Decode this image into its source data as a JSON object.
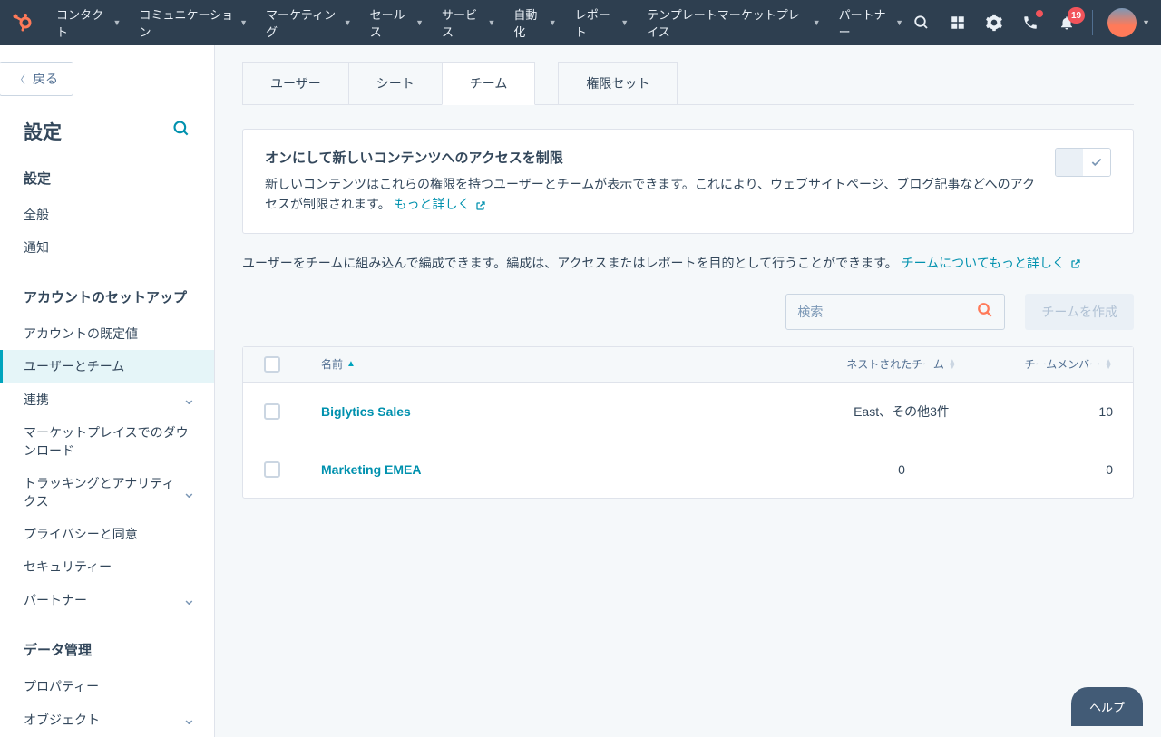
{
  "topnav": {
    "items": [
      "コンタクト",
      "コミュニケーション",
      "マーケティング",
      "セールス",
      "サービス",
      "自動化",
      "レポート",
      "テンプレートマーケットプレイス",
      "パートナー"
    ],
    "bell_badge": "19"
  },
  "sidebar": {
    "back": "戻る",
    "title": "設定",
    "sections": [
      {
        "heading": "設定",
        "items": [
          {
            "label": "全般"
          },
          {
            "label": "通知"
          }
        ]
      },
      {
        "heading": "アカウントのセットアップ",
        "items": [
          {
            "label": "アカウントの既定値"
          },
          {
            "label": "ユーザーとチーム",
            "active": true
          },
          {
            "label": "連携",
            "expandable": true
          },
          {
            "label": "マーケットプレイスでのダウンロード"
          },
          {
            "label": "トラッキングとアナリティクス",
            "expandable": true
          },
          {
            "label": "プライバシーと同意"
          },
          {
            "label": "セキュリティー"
          },
          {
            "label": "パートナー",
            "expandable": true
          }
        ]
      },
      {
        "heading": "データ管理",
        "items": [
          {
            "label": "プロパティー"
          },
          {
            "label": "オブジェクト",
            "expandable": true
          }
        ]
      }
    ]
  },
  "tabs": [
    {
      "label": "ユーザー"
    },
    {
      "label": "シート"
    },
    {
      "label": "チーム",
      "active": true
    },
    {
      "label": "権限セット",
      "detached": true
    }
  ],
  "notice": {
    "title": "オンにして新しいコンテンツへのアクセスを制限",
    "desc": "新しいコンテンツはこれらの権限を持つユーザーとチームが表示できます。これにより、ウェブサイトページ、ブログ記事などへのアクセスが制限されます。",
    "link": "もっと詳しく"
  },
  "desc_line": {
    "text": "ユーザーをチームに組み込んで編成できます。編成は、アクセスまたはレポートを目的として行うことができます。",
    "link": "チームについてもっと詳しく"
  },
  "toolbar": {
    "search_placeholder": "検索",
    "create_label": "チームを作成"
  },
  "table": {
    "headers": {
      "name": "名前",
      "nested": "ネストされたチーム",
      "members": "チームメンバー"
    },
    "rows": [
      {
        "name": "Biglytics Sales",
        "nested": "East、その他3件",
        "members": "10"
      },
      {
        "name": "Marketing EMEA",
        "nested": "0",
        "members": "0"
      }
    ]
  },
  "help": "ヘルプ"
}
